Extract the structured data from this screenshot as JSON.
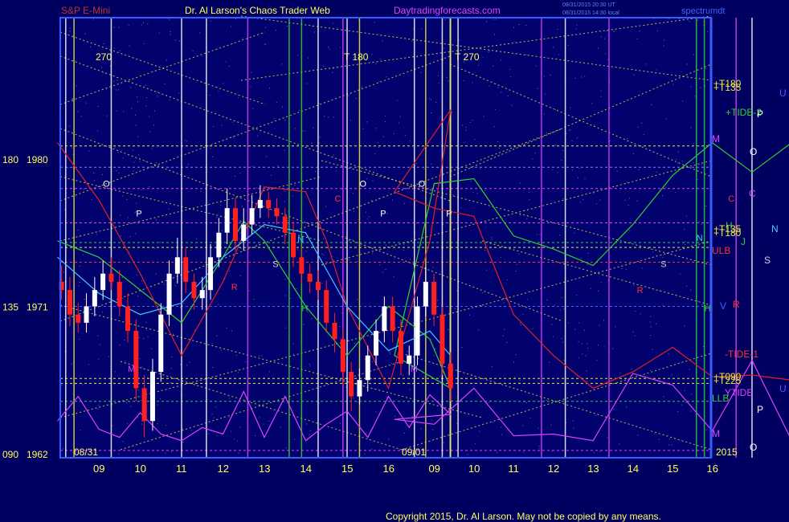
{
  "header": {
    "instrument": "S&P E-Mini",
    "site_title": "Dr. Al Larson's Chaos Trader Web",
    "site_url": "Daytradingforecasts.com",
    "corner_label": "spectrumdt",
    "timestamp_1": "08/31/2015 20:30 UT",
    "timestamp_2": "08/31/2015 14:30 local",
    "copyright": "Copyright 2015, Dr. Al Larson. May not be copied by any means."
  },
  "colors": {
    "background": "#000060",
    "white_candle": "#ffffff",
    "red_candle": "#ff2020",
    "magenta": "#e040ff",
    "cyan": "#40c8ff",
    "green": "#30d030",
    "yellow": "#e8e840",
    "red_line": "#e02020"
  },
  "chart_data": {
    "type": "line",
    "x_dates": [
      "08/31",
      "09/01"
    ],
    "x_ticks": [
      "09",
      "10",
      "11",
      "12",
      "13",
      "14",
      "15",
      "16",
      "09",
      "10",
      "11",
      "12",
      "13",
      "14",
      "15",
      "16"
    ],
    "y_ticks": [
      {
        "angle": "180",
        "price": "1980",
        "value": 1980
      },
      {
        "angle": "135",
        "price": "1971",
        "value": 1971
      },
      {
        "angle": "090",
        "price": "1962",
        "value": 1962
      }
    ],
    "ylim": [
      1962,
      1980
    ],
    "year_label": "2015",
    "top_angle_labels": [
      {
        "x_hour": 9.0,
        "text": "270"
      },
      {
        "x_hour": 15.0,
        "text": "T 180"
      },
      {
        "x_hour": 25.6,
        "text": "T 270"
      },
      {
        "x_hour": 35.7,
        "text": "T 180"
      }
    ],
    "right_labels": [
      {
        "text": "+T180",
        "color": "#e8e840"
      },
      {
        "text": "+T135",
        "color": "#e8e840"
      },
      {
        "text": "+TIDE-2",
        "color": "#30d030"
      },
      {
        "text": "P",
        "color": "#ffffff"
      },
      {
        "text": "U",
        "color": "#4060ff"
      },
      {
        "text": "M",
        "color": "#e040ff"
      },
      {
        "text": "O",
        "color": "#ffffff"
      },
      {
        "text": "C",
        "color": "#e040ff"
      },
      {
        "text": "N",
        "color": "#40c8ff"
      },
      {
        "text": "H",
        "color": "#30d030"
      },
      {
        "text": "+T135",
        "color": "#e8e840"
      },
      {
        "text": "+T180",
        "color": "#e8e840"
      },
      {
        "text": "J",
        "color": "#30d030"
      },
      {
        "text": "ULB",
        "color": "#ff3030"
      },
      {
        "text": "S",
        "color": "#d0d0d0"
      },
      {
        "text": "V",
        "color": "#4060ff"
      },
      {
        "text": "R",
        "color": "#ff3030"
      },
      {
        "text": "-TIDE-1",
        "color": "#ff3030"
      },
      {
        "text": "+T090",
        "color": "#e8e840"
      },
      {
        "text": "+T225",
        "color": "#e8e840"
      },
      {
        "text": "YTIDE",
        "color": "#e040ff"
      },
      {
        "text": "U",
        "color": "#4060ff"
      },
      {
        "text": "LLB",
        "color": "#30d030"
      },
      {
        "text": "P",
        "color": "#ffffff"
      },
      {
        "text": "M",
        "color": "#e040ff"
      },
      {
        "text": "O",
        "color": "#ffffff"
      }
    ],
    "planet_marks": [
      {
        "x_hour": 9.1,
        "value": 1978.3,
        "text": "O",
        "color": "#ffffff"
      },
      {
        "x_hour": 9.9,
        "value": 1976.5,
        "text": "P",
        "color": "#ffffff"
      },
      {
        "x_hour": 9.7,
        "value": 1967.0,
        "text": "M",
        "color": "#e040ff"
      },
      {
        "x_hour": 12.2,
        "value": 1972.0,
        "text": "R",
        "color": "#ff3030"
      },
      {
        "x_hour": 13.2,
        "value": 1973.4,
        "text": "S",
        "color": "#d0d0d0"
      },
      {
        "x_hour": 13.8,
        "value": 1974.9,
        "text": "N",
        "color": "#40c8ff"
      },
      {
        "x_hour": 13.9,
        "value": 1970.7,
        "text": "H",
        "color": "#30d030"
      },
      {
        "x_hour": 14.7,
        "value": 1977.4,
        "text": "C",
        "color": "#ff3030"
      },
      {
        "x_hour": 15.3,
        "value": 1978.3,
        "text": "O",
        "color": "#ffffff"
      },
      {
        "x_hour": 15.8,
        "value": 1976.5,
        "text": "P",
        "color": "#ffffff"
      },
      {
        "x_hour": 24.4,
        "value": 1967.0,
        "text": "M",
        "color": "#e040ff"
      },
      {
        "x_hour": 24.6,
        "value": 1978.3,
        "text": "O",
        "color": "#ffffff"
      },
      {
        "x_hour": 25.3,
        "value": 1976.5,
        "text": "P",
        "color": "#ffffff"
      },
      {
        "x_hour": 30.1,
        "value": 1971.8,
        "text": "R",
        "color": "#ff3030"
      },
      {
        "x_hour": 30.7,
        "value": 1973.4,
        "text": "S",
        "color": "#d0d0d0"
      },
      {
        "x_hour": 31.6,
        "value": 1975.0,
        "text": "N",
        "color": "#40c8ff"
      },
      {
        "x_hour": 31.8,
        "value": 1970.7,
        "text": "H",
        "color": "#30d030"
      },
      {
        "x_hour": 32.4,
        "value": 1977.4,
        "text": "C",
        "color": "#ff3030"
      },
      {
        "x_hour": 34.3,
        "value": 1978.3,
        "text": "O",
        "color": "#ffffff"
      },
      {
        "x_hour": 34.4,
        "value": 1967.0,
        "text": "M",
        "color": "#e040ff"
      },
      {
        "x_hour": 35.0,
        "value": 1976.5,
        "text": "P",
        "color": "#ffffff"
      }
    ],
    "vertical_lines": [
      {
        "x_hour": 8.2,
        "color": "#ffffff"
      },
      {
        "x_hour": 8.4,
        "color": "#e8e840"
      },
      {
        "x_hour": 9.3,
        "color": "#ffffff"
      },
      {
        "x_hour": 11.0,
        "color": "#ffffff"
      },
      {
        "x_hour": 11.6,
        "color": "#ffffff"
      },
      {
        "x_hour": 12.6,
        "color": "#e040ff"
      },
      {
        "x_hour": 13.6,
        "color": "#30d030"
      },
      {
        "x_hour": 13.9,
        "color": "#30d030"
      },
      {
        "x_hour": 14.3,
        "color": "#ffffff"
      },
      {
        "x_hour": 14.9,
        "color": "#e040ff"
      },
      {
        "x_hour": 15.0,
        "color": "#ffffff"
      },
      {
        "x_hour": 15.3,
        "color": "#e8e840"
      },
      {
        "x_hour": 16.9,
        "color": "#e8e840"
      },
      {
        "x_hour": 17.3,
        "color": "#ffffff"
      },
      {
        "x_hour": 17.5,
        "color": "#ffffff"
      },
      {
        "x_hour": 24.5,
        "color": "#ffffff"
      },
      {
        "x_hour": 25.4,
        "color": "#e8e840"
      },
      {
        "x_hour": 25.6,
        "color": "#ffffff"
      },
      {
        "x_hour": 27.7,
        "color": "#e040ff"
      },
      {
        "x_hour": 28.3,
        "color": "#ffffff"
      },
      {
        "x_hour": 29.4,
        "color": "#e040ff"
      },
      {
        "x_hour": 31.6,
        "color": "#30d030"
      },
      {
        "x_hour": 31.8,
        "color": "#30d030"
      },
      {
        "x_hour": 32.6,
        "color": "#e040ff"
      },
      {
        "x_hour": 33.0,
        "color": "#ffffff"
      },
      {
        "x_hour": 34.7,
        "color": "#e040ff"
      },
      {
        "x_hour": 35.2,
        "color": "#ffffff"
      },
      {
        "x_hour": 35.7,
        "color": "#e8e840"
      }
    ],
    "horizontal_lines": [
      {
        "value": 1980.8,
        "color": "#e8e840"
      },
      {
        "value": 1979.5,
        "color": "#8080ff"
      },
      {
        "value": 1978.2,
        "color": "#e040ff"
      },
      {
        "value": 1976.1,
        "color": "#e040ff"
      },
      {
        "value": 1974.9,
        "color": "#30d030"
      },
      {
        "value": 1974.6,
        "color": "#e8e840"
      },
      {
        "value": 1973.7,
        "color": "#ff3030"
      },
      {
        "value": 1971.0,
        "color": "#4060ff"
      },
      {
        "value": 1966.6,
        "color": "#e8e840"
      },
      {
        "value": 1966.3,
        "color": "#e8e840"
      },
      {
        "value": 1965.2,
        "color": "#30d030"
      },
      {
        "value": 1962.2,
        "color": "#e040ff"
      }
    ],
    "series": [
      {
        "color": "#e040ff",
        "x": [
          8.0,
          8.5,
          9.0,
          9.5,
          10.0,
          10.5,
          11.0,
          11.5,
          12.0,
          12.5,
          13.0,
          13.5,
          14.0,
          14.5,
          15.0,
          15.5,
          16.0,
          16.5,
          17.0,
          17.5,
          24.0,
          25.0,
          26.0,
          27.0,
          28.0,
          29.0,
          30.0,
          31.0,
          32.0,
          33.0,
          34.0,
          35.0,
          36.0
        ],
        "values": [
          1964.0,
          1965.5,
          1963.5,
          1963.0,
          1964.5,
          1963.2,
          1962.8,
          1963.6,
          1963.2,
          1965.8,
          1963.0,
          1965.5,
          1962.8,
          1963.8,
          1964.6,
          1963.0,
          1965.5,
          1963.6,
          1965.6,
          1964.4,
          1964.1,
          1963.8,
          1966.0,
          1963.1,
          1963.2,
          1962.8,
          1966.9,
          1966.2,
          1963.4,
          1967.7,
          1962.8,
          1966.4,
          1963.0
        ]
      },
      {
        "color": "#30d030",
        "x": [
          8.0,
          9.0,
          10.0,
          11.0,
          12.0,
          12.5,
          13.0,
          14.0,
          15.0,
          16.0,
          17.0,
          17.5,
          24.0,
          25.0,
          26.0,
          27.0,
          28.0,
          29.0,
          30.0,
          31.0,
          32.0,
          33.0,
          34.0,
          35.0,
          36.0
        ],
        "values": [
          1975.0,
          1974.0,
          1972.0,
          1970.0,
          1974.0,
          1976.2,
          1975.0,
          1971.0,
          1968.0,
          1971.0,
          1969.0,
          1966.0,
          1968.0,
          1978.5,
          1978.8,
          1975.3,
          1974.5,
          1973.5,
          1976.0,
          1979.0,
          1981.0,
          1979.2,
          1981.0,
          1978.9,
          1979.2
        ]
      },
      {
        "color": "#e02020",
        "x": [
          8.0,
          9.0,
          10.0,
          11.0,
          12.0,
          13.0,
          14.0,
          14.5,
          15.0,
          16.0,
          17.0,
          17.5,
          24.0,
          25.0,
          26.0,
          27.0,
          28.0,
          29.0,
          30.0,
          31.0,
          32.0,
          33.0,
          34.0,
          35.0,
          36.0
        ],
        "values": [
          1981.0,
          1977.5,
          1973.0,
          1968.0,
          1972.5,
          1978.3,
          1978.0,
          1975.0,
          1971.0,
          1966.0,
          1975.0,
          1983.0,
          1978.0,
          1977.0,
          1976.5,
          1970.5,
          1968.0,
          1966.0,
          1967.0,
          1968.5,
          1966.7,
          1966.8,
          1966.5,
          1969.4,
          1967.3
        ]
      },
      {
        "color": "#40c8ff",
        "x": [
          8.0,
          9.0,
          10.0,
          11.0,
          12.0,
          13.0,
          14.0,
          15.0,
          16.0,
          17.0,
          17.5
        ],
        "values": [
          1974.0,
          1971.8,
          1970.5,
          1971.2,
          1974.0,
          1976.0,
          1975.5,
          1971.0,
          1968.3,
          1969.5,
          1968.0
        ]
      }
    ],
    "price_bars": {
      "x": [
        8.1,
        8.3,
        8.5,
        8.7,
        8.9,
        9.1,
        9.3,
        9.5,
        9.7,
        9.9,
        10.1,
        10.3,
        10.5,
        10.7,
        10.9,
        11.1,
        11.3,
        11.5,
        11.7,
        11.9,
        12.1,
        12.3,
        12.5,
        12.7,
        12.9,
        13.1,
        13.3,
        13.5,
        13.7,
        13.9,
        14.1,
        14.3,
        14.5,
        14.7,
        14.9,
        15.1,
        15.3,
        15.5,
        15.7,
        15.9,
        16.1,
        16.3,
        16.5,
        16.7,
        16.9,
        17.1,
        17.3,
        17.5
      ],
      "open": [
        1972.5,
        1972.0,
        1970.5,
        1970.0,
        1971.0,
        1972.0,
        1973.0,
        1972.5,
        1971.0,
        1969.5,
        1966.0,
        1964.0,
        1967.0,
        1970.5,
        1973.0,
        1974.0,
        1972.5,
        1971.5,
        1972.0,
        1974.0,
        1975.5,
        1977.0,
        1975.0,
        1976.0,
        1977.0,
        1977.5,
        1977.0,
        1976.5,
        1975.5,
        1974.0,
        1973.0,
        1972.5,
        1972.0,
        1970.0,
        1969.0,
        1967.0,
        1965.5,
        1966.5,
        1968.0,
        1969.5,
        1971.0,
        1969.5,
        1967.5,
        1968.0,
        1971.0,
        1972.5,
        1970.5,
        1967.5
      ],
      "close": [
        1972.0,
        1970.5,
        1970.0,
        1971.0,
        1972.0,
        1973.0,
        1972.5,
        1971.0,
        1969.5,
        1966.0,
        1964.0,
        1967.0,
        1970.5,
        1973.0,
        1974.0,
        1972.5,
        1971.5,
        1972.0,
        1974.0,
        1975.5,
        1977.0,
        1975.0,
        1976.0,
        1977.0,
        1977.5,
        1977.0,
        1976.5,
        1975.5,
        1974.0,
        1973.0,
        1972.5,
        1972.0,
        1970.0,
        1969.0,
        1967.0,
        1965.5,
        1966.5,
        1968.0,
        1969.5,
        1971.0,
        1969.5,
        1967.5,
        1968.0,
        1971.0,
        1972.5,
        1970.5,
        1967.5,
        1966.0
      ],
      "high": [
        1973.5,
        1972.8,
        1971.2,
        1971.8,
        1972.8,
        1973.8,
        1974.0,
        1973.2,
        1971.8,
        1970.2,
        1966.8,
        1967.8,
        1971.2,
        1973.8,
        1975.2,
        1974.6,
        1973.0,
        1972.8,
        1974.8,
        1976.4,
        1978.2,
        1977.6,
        1977.0,
        1977.8,
        1978.4,
        1978.0,
        1977.6,
        1977.0,
        1976.2,
        1974.6,
        1973.6,
        1973.2,
        1972.6,
        1970.6,
        1969.6,
        1967.6,
        1967.2,
        1968.6,
        1970.2,
        1971.6,
        1971.6,
        1970.2,
        1968.6,
        1971.6,
        1973.4,
        1973.0,
        1971.0,
        1968.2
      ],
      "low": [
        1971.4,
        1969.8,
        1969.4,
        1969.4,
        1970.4,
        1971.4,
        1972.0,
        1970.4,
        1968.8,
        1965.2,
        1963.0,
        1963.4,
        1966.4,
        1969.8,
        1972.4,
        1971.8,
        1970.8,
        1970.8,
        1971.4,
        1973.4,
        1974.8,
        1974.4,
        1974.4,
        1975.4,
        1976.4,
        1976.4,
        1976.0,
        1974.8,
        1973.4,
        1972.4,
        1971.8,
        1971.4,
        1969.4,
        1968.2,
        1966.2,
        1964.6,
        1965.0,
        1965.8,
        1967.4,
        1968.8,
        1968.8,
        1966.8,
        1966.8,
        1967.4,
        1970.4,
        1969.8,
        1966.8,
        1965.2
      ]
    }
  }
}
